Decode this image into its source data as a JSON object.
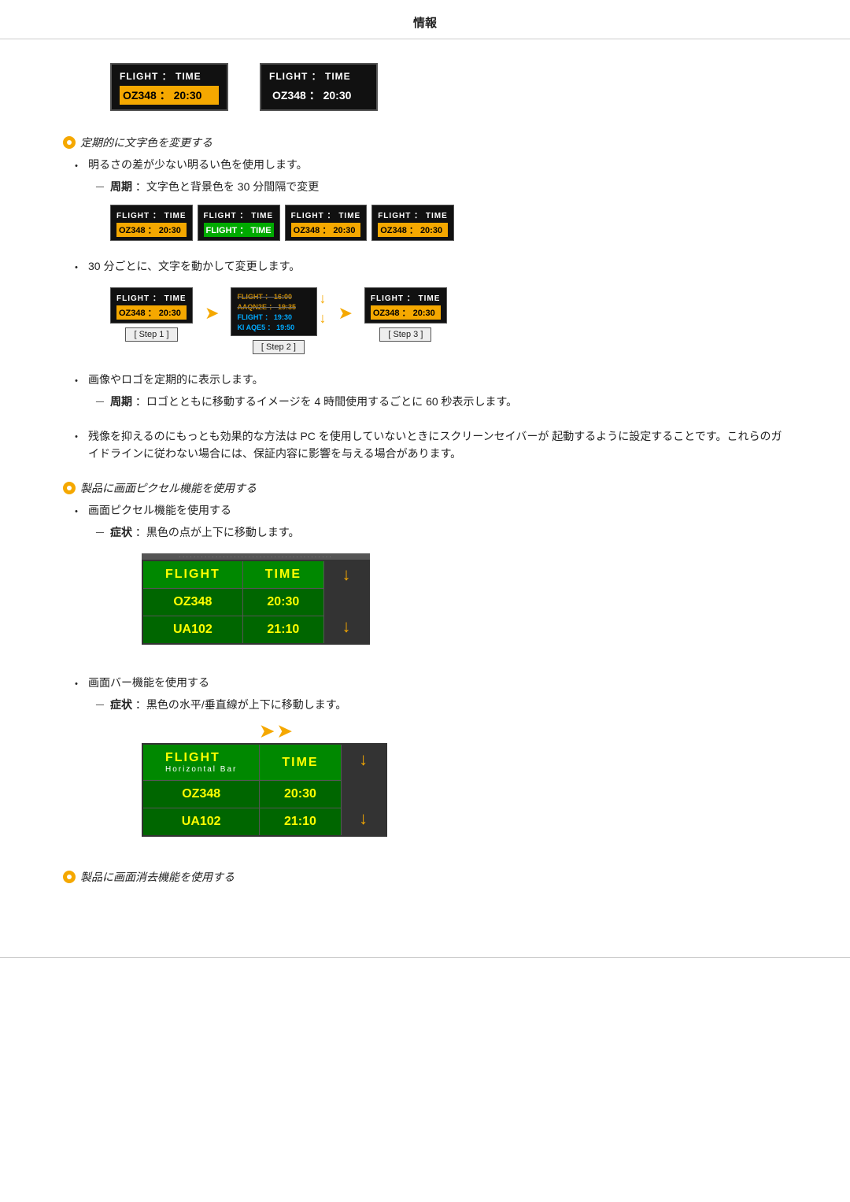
{
  "header": {
    "title": "情報"
  },
  "top_displays": [
    {
      "style": "highlighted",
      "header": "FLIGHT  ：  TIME",
      "data": "OZ348  ：  20:30"
    },
    {
      "style": "plain",
      "header": "FLIGHT  ：  TIME",
      "data": "OZ348  ：  20:30"
    }
  ],
  "sections": [
    {
      "type": "orange-heading",
      "text": "定期的に文字色を変更する"
    },
    {
      "type": "bullet",
      "text": "明るさの差が少ない明るい色を使用します。"
    },
    {
      "type": "sub",
      "label": "周期",
      "text": "：文字色と背景色を 30 分間隔で変更"
    },
    {
      "type": "bullet",
      "text": "30 分ごとに、文字を動かして変更します。"
    },
    {
      "type": "bullet",
      "text": "画像やロゴを定期的に表示します。"
    },
    {
      "type": "sub",
      "label": "周期",
      "text": "：ロゴとともに移動するイメージを 4 時間使用するごとに 60 秒表示します。"
    },
    {
      "type": "bullet",
      "text": "残像を抑えるのにもっとも効果的な方法は PC を使用していないときにスクリーンセイバーが 起動するように設定することです。これらのガイドラインに従わない場合には、保証内容に影響を与える場合があります。"
    },
    {
      "type": "orange-heading",
      "text": "製品に画面ピクセル機能を使用する"
    },
    {
      "type": "bullet",
      "text": "画面ピクセル機能を使用する"
    },
    {
      "type": "sub",
      "label": "症状",
      "text": "：黒色の点が上下に移動します。"
    },
    {
      "type": "bullet",
      "text": "画面バー機能を使用する"
    },
    {
      "type": "sub",
      "label": "症状",
      "text": "：黒色の水平/垂直線が上下に移動します。"
    },
    {
      "type": "orange-heading",
      "text": "製品に画面消去機能を使用する"
    }
  ],
  "demo_boxes": [
    {
      "header": "FLIGHT  ：  TIME",
      "data": "OZ348  ：  20:30",
      "data_style": "orange"
    },
    {
      "header": "FLIGHT  ：  TIME",
      "data": "FLIGHT  ：  TIME",
      "data_style": "green"
    },
    {
      "header": "FLIGHT  ：  TIME",
      "data": "OZ348  ：  20:30",
      "data_style": "orange"
    },
    {
      "header": "FLIGHT  ：  TIME",
      "data": "OZ348  ：  20:30",
      "data_style": "orange"
    }
  ],
  "steps": [
    {
      "label": "[ Step 1 ]",
      "header": "FLIGHT  ：  TIME",
      "data": "OZ348  ：  20:30",
      "data_style": "orange"
    },
    {
      "label": "[ Step 2 ]",
      "row1": "FLIGHT  ：  16:00 / AAQN2E  ：  19:35",
      "row2": "FLIGHT  ：  19:30 / KI AQE5  ：  19:50"
    },
    {
      "label": "[ Step 3 ]",
      "header": "FLIGHT  ：  TIME",
      "data": "OZ348  ：  20:30",
      "data_style": "orange"
    }
  ],
  "pixel_table": {
    "headers": [
      "FLIGHT",
      "TIME"
    ],
    "rows": [
      [
        "OZ348",
        "20:30"
      ],
      [
        "UA102",
        "21:10"
      ]
    ]
  },
  "hbar_table": {
    "flight_header": "FLIGHT",
    "time_header": "TIME",
    "sub_label": "Horizontal Bar",
    "rows": [
      [
        "OZ348",
        "20:30"
      ],
      [
        "UA102",
        "21:10"
      ]
    ]
  }
}
